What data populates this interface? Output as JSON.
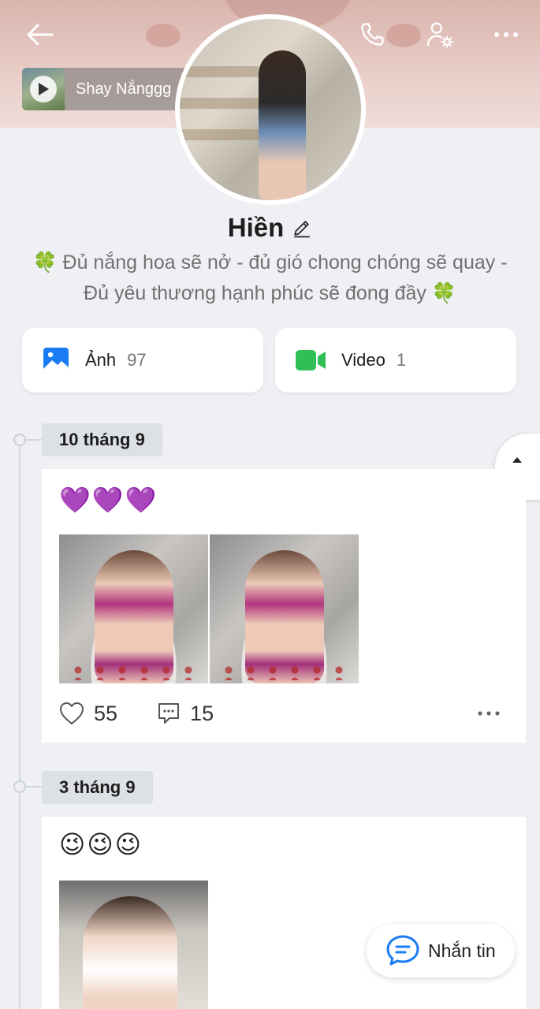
{
  "header": {
    "music": {
      "title": "Shay Nắnggg"
    }
  },
  "profile": {
    "name": "Hiền",
    "bio_line1": "🍀 Đủ nắng hoa sẽ nở - đủ gió chong chóng sẽ quay -",
    "bio_line2": "Đủ yêu thương hạnh phúc sẽ đong đầy 🍀"
  },
  "media": {
    "photos": {
      "label": "Ảnh",
      "count": "97"
    },
    "videos": {
      "label": "Video",
      "count": "1"
    }
  },
  "timeline": [
    {
      "date": "10 tháng 9",
      "text": "💜💜💜",
      "likes": "55",
      "comments": "15"
    },
    {
      "date": "3 tháng 9",
      "text": "😉😉😉"
    }
  ],
  "message_button": {
    "label": "Nhắn tin"
  },
  "colors": {
    "accent_blue": "#1a7cf4",
    "video_green": "#2fbf56",
    "background": "#eef0f4"
  }
}
